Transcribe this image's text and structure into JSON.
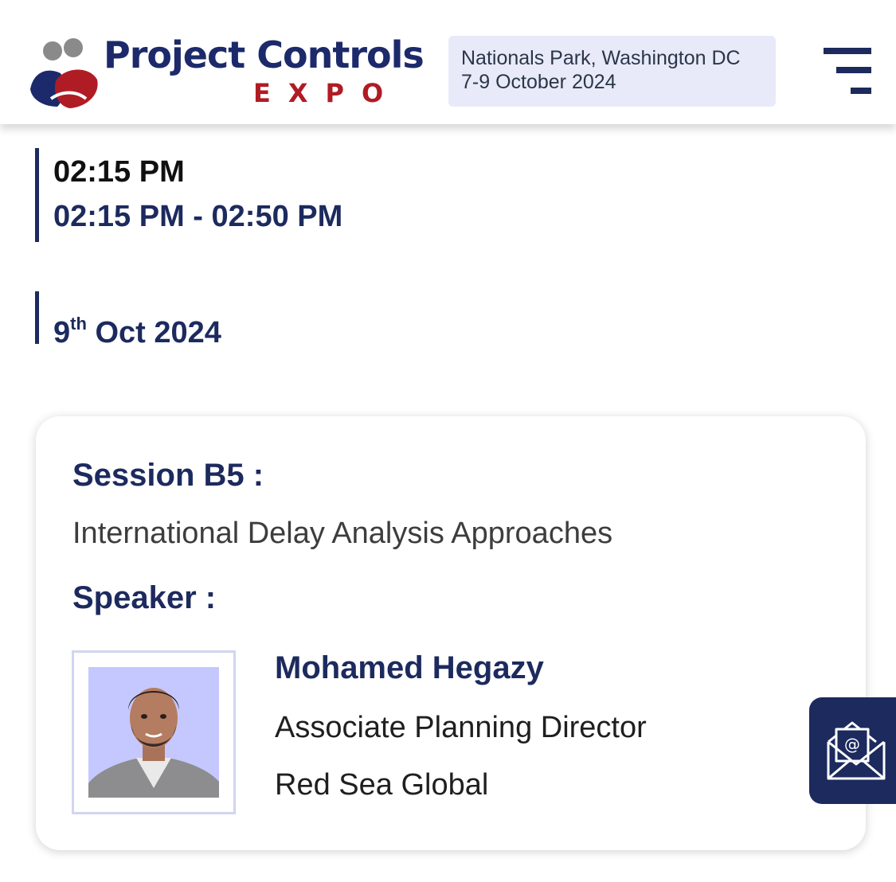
{
  "header": {
    "logo": {
      "title": "Project Controls",
      "subtitle": "EXPO"
    },
    "venue": {
      "location": "Nationals Park, Washington DC",
      "dates": "7-9 October 2024"
    },
    "menu_icon": "hamburger-menu-icon"
  },
  "schedule": {
    "start_time": "02:15 PM",
    "time_range": "02:15 PM - 02:50 PM",
    "date_day": "9",
    "date_suffix": "th",
    "date_rest": " Oct 2024"
  },
  "session": {
    "label": "Session B5 :",
    "title": "International Delay Analysis Approaches",
    "speaker_label": "Speaker :",
    "speaker": {
      "name": "Mohamed Hegazy",
      "role": "Associate Planning Director",
      "organization": "Red Sea Global"
    }
  },
  "floating": {
    "email_icon": "email-envelope-icon"
  },
  "colors": {
    "brand_navy": "#1c2a5e",
    "brand_red": "#b01c24",
    "venue_bg": "#e8eaf9",
    "photo_bg": "#c5c8ff"
  }
}
